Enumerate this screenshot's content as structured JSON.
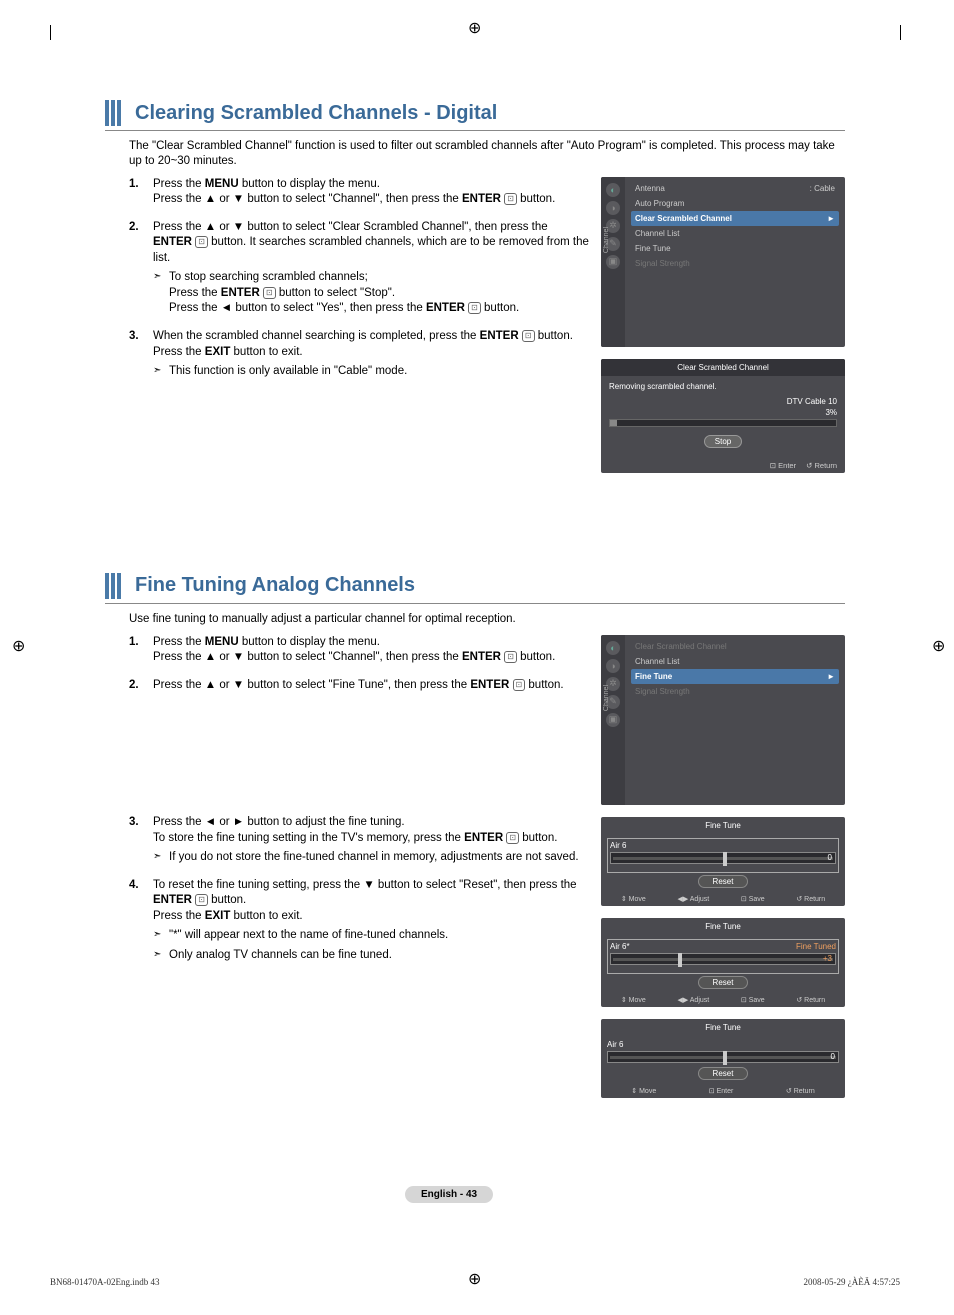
{
  "section1": {
    "title": "Clearing Scrambled Channels - Digital",
    "intro": "The \"Clear Scrambled Channel\" function is used to filter out scrambled channels after \"Auto Program\" is completed. This process may take up to 20~30 minutes.",
    "steps": [
      {
        "num": "1.",
        "paras": [
          "Press the <b>MENU</b> button to display the menu.",
          "Press the ▲ or ▼ button to select \"Channel\", then press the <b>ENTER</b> <e></e> button."
        ]
      },
      {
        "num": "2.",
        "paras": [
          "Press the ▲ or ▼ button to select \"Clear Scrambled Channel\", then press the <b>ENTER</b> <e></e> button. It searches scrambled channels, which are to be removed from the list."
        ],
        "notes": [
          "To stop searching scrambled channels;<br>Press the <b>ENTER</b> <e></e> button to select \"Stop\".<br>Press the ◄ button to select \"Yes\", then press the <b>ENTER</b> <e></e> button."
        ]
      },
      {
        "num": "3.",
        "paras": [
          "When the scrambled channel searching is completed, press the <b>ENTER</b> <e></e> button.",
          "Press the <b>EXIT</b> button to exit."
        ],
        "notes": [
          "This function is only available in \"Cable\" mode."
        ]
      }
    ],
    "osd_menu": {
      "tab_label": "Channel",
      "items": [
        {
          "label": "Antenna",
          "value": ": Cable"
        },
        {
          "label": "Auto Program"
        },
        {
          "label": "Clear Scrambled Channel",
          "selected": true
        },
        {
          "label": "Channel List"
        },
        {
          "label": "Fine Tune"
        },
        {
          "label": "Signal Strength",
          "dim": true
        }
      ]
    },
    "osd_scan": {
      "title": "Clear Scrambled Channel",
      "msg": "Removing scrambled channel.",
      "subinfo": "DTV Cable 10",
      "percent": "3%",
      "fill_pct": 3,
      "stop": "Stop",
      "footer_enter": "Enter",
      "footer_return": "Return"
    }
  },
  "section2": {
    "title": "Fine Tuning Analog Channels",
    "intro": "Use fine tuning to manually adjust a particular channel for optimal reception.",
    "steps": [
      {
        "num": "1.",
        "paras": [
          "Press the <b>MENU</b> button to display the menu.",
          "Press the ▲ or ▼ button to select \"Channel\", then press the <b>ENTER</b> <e></e> button."
        ]
      },
      {
        "num": "2.",
        "paras": [
          "Press the ▲ or ▼ button to select \"Fine Tune\", then press the <b>ENTER</b> <e></e> button."
        ]
      },
      {
        "num": "3.",
        "paras": [
          "Press the ◄ or ► button to adjust the fine tuning.",
          "To store the fine tuning setting in the TV's memory, press the <b>ENTER</b> <e></e> button."
        ],
        "notes": [
          "If you do not store the fine-tuned channel in memory, adjustments are not saved."
        ]
      },
      {
        "num": "4.",
        "paras": [
          "To reset the fine tuning setting, press the ▼ button to select \"Reset\", then press  the <b>ENTER</b> <e></e> button.",
          "Press the <b>EXIT</b> button to exit."
        ],
        "notes": [
          "\"*\" will appear next to the name of fine-tuned channels.",
          "Only analog TV channels can be fine tuned."
        ]
      }
    ],
    "osd_menu": {
      "tab_label": "Channel",
      "items": [
        {
          "label": "Clear Scrambled Channel",
          "dim": true
        },
        {
          "label": "Channel List"
        },
        {
          "label": "Fine Tune",
          "selected": true
        },
        {
          "label": "Signal Strength",
          "dim": true
        }
      ]
    },
    "osd_ft1": {
      "title": "Fine Tune",
      "channel": "Air 6",
      "val": "0",
      "handle_pct": 50,
      "reset": "Reset",
      "boxed": true,
      "footer": {
        "move": "Move",
        "adjust": "Adjust",
        "save": "Save",
        "ret": "Return"
      }
    },
    "osd_ft2": {
      "title": "Fine Tune",
      "channel": "Air 6*",
      "status": "Fine Tuned",
      "val": "+3",
      "handle_pct": 30,
      "reset": "Reset",
      "boxed": true,
      "footer": {
        "move": "Move",
        "adjust": "Adjust",
        "save": "Save",
        "ret": "Return"
      }
    },
    "osd_ft3": {
      "title": "Fine Tune",
      "channel": "Air 6",
      "val": "0",
      "handle_pct": 50,
      "reset": "Reset",
      "boxed": false,
      "footer": {
        "move": "Move",
        "enter": "Enter",
        "ret": "Return"
      }
    }
  },
  "page_num": "English - 43",
  "footer": {
    "file": "BN68-01470A-02Eng.indb   43",
    "date": "2008-05-29   ¿ÀÈÄ 4:57:25"
  },
  "icons": {
    "enter": "⊡",
    "return": "↺",
    "move": "⇕",
    "adjust": "◀▶"
  }
}
